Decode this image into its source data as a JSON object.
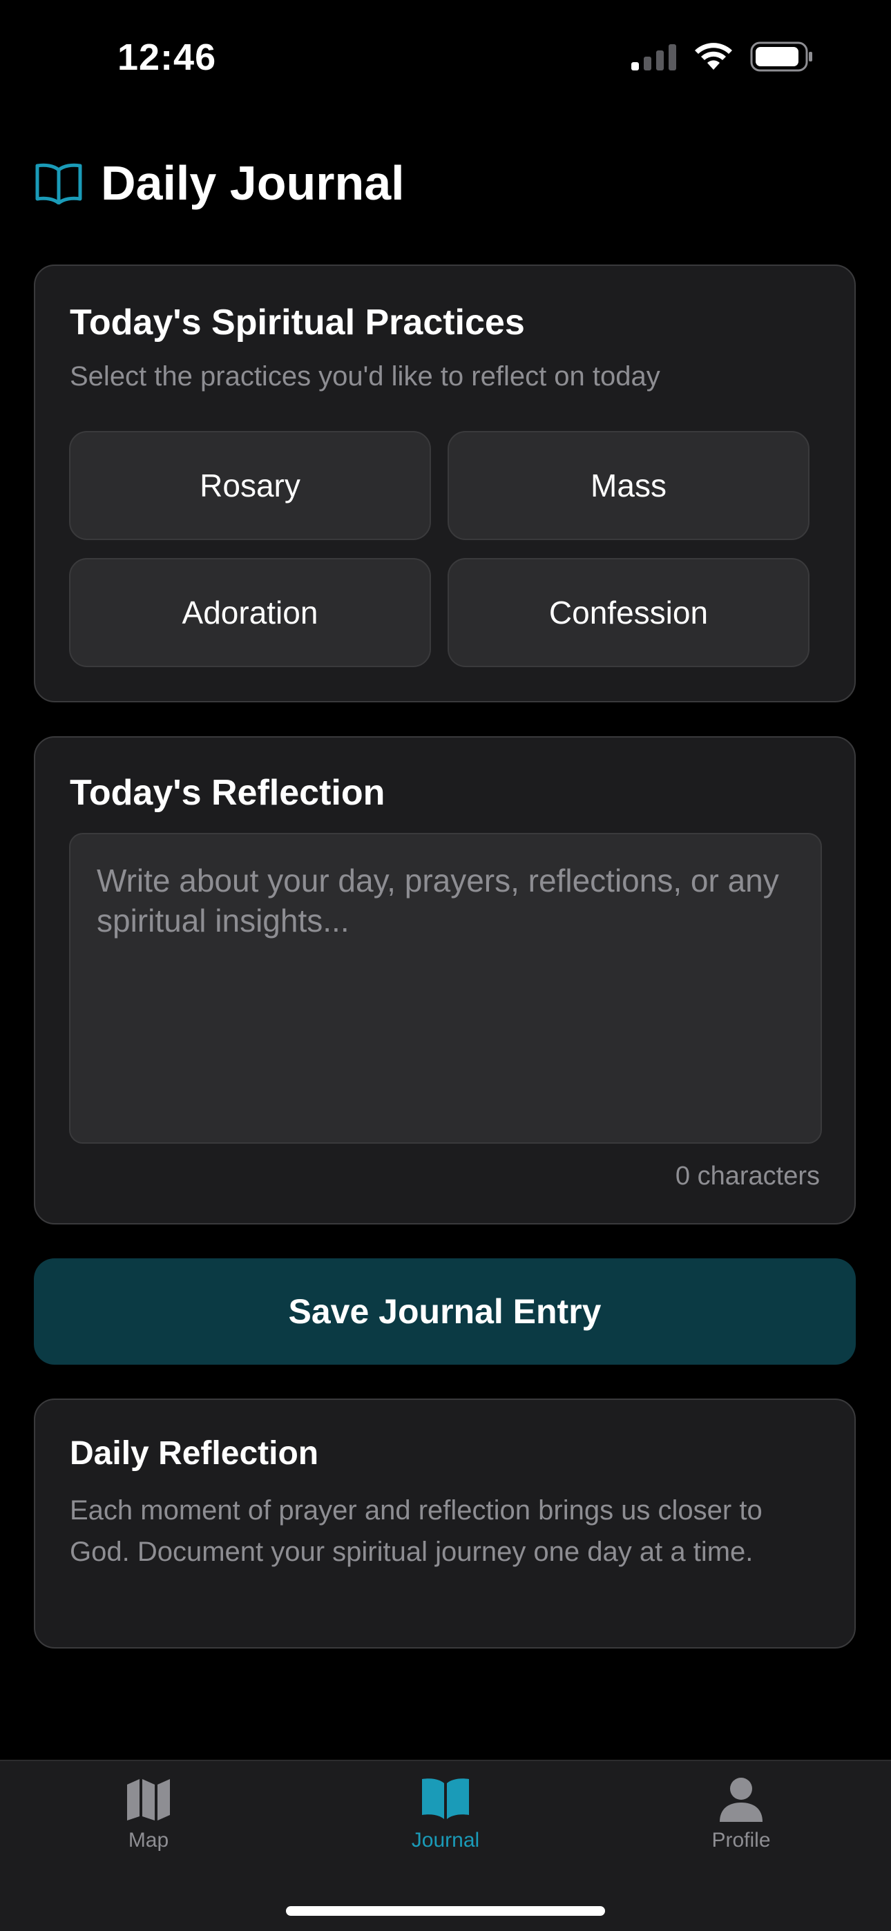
{
  "status_bar": {
    "time": "12:46"
  },
  "header": {
    "title": "Daily Journal",
    "icon": "open-book-icon",
    "accent_color": "#1a9bb8"
  },
  "practices": {
    "title": "Today's Spiritual Practices",
    "subtitle": "Select the practices you'd like to reflect on today",
    "options": [
      "Rosary",
      "Mass",
      "Adoration",
      "Confession"
    ]
  },
  "reflection": {
    "title": "Today's Reflection",
    "placeholder": "Write about your day, prayers, reflections, or any spiritual insights...",
    "value": "",
    "char_count": "0 characters"
  },
  "save_button": {
    "label": "Save Journal Entry",
    "color": "#0b3a44"
  },
  "daily_reflection": {
    "title": "Daily Reflection",
    "text": "Each moment of prayer and reflection brings us closer to God. Document your spiritual journey one day at a time."
  },
  "tab_bar": {
    "items": [
      {
        "label": "Map",
        "icon": "map-icon",
        "active": false
      },
      {
        "label": "Journal",
        "icon": "book-icon",
        "active": true
      },
      {
        "label": "Profile",
        "icon": "person-icon",
        "active": false
      }
    ],
    "active_color": "#1a9bb8",
    "inactive_color": "#8e8e93"
  }
}
